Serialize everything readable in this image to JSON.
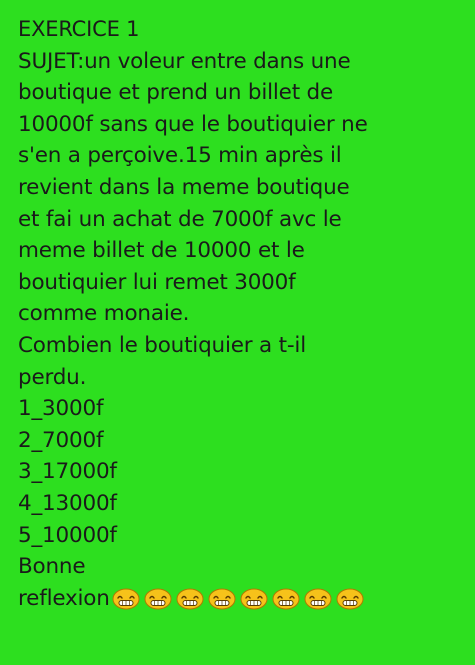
{
  "exercise": {
    "title": "EXERCICE 1",
    "lines": [
      "SUJET:un voleur entre dans une",
      "boutique et prend un billet de",
      "10000f sans que le boutiquier ne",
      "s'en a perçoive.15 min après il",
      "revient dans la meme boutique",
      "et fai un achat de 7000f avc le",
      "meme billet de 10000 et le",
      "boutiquier lui remet 3000f",
      "comme monaie.",
      "Combien le boutiquier a t-il",
      "perdu."
    ],
    "options": [
      "1_3000f",
      "2_7000f",
      "3_17000f",
      "4_13000f",
      "5_10000f"
    ],
    "closing_1": "Bonne",
    "closing_2": "reflexion",
    "emoji": {
      "name": "grinning-face-icon",
      "count": 8,
      "face_color": "#f6c21a",
      "outline_color": "#b07a00"
    }
  }
}
